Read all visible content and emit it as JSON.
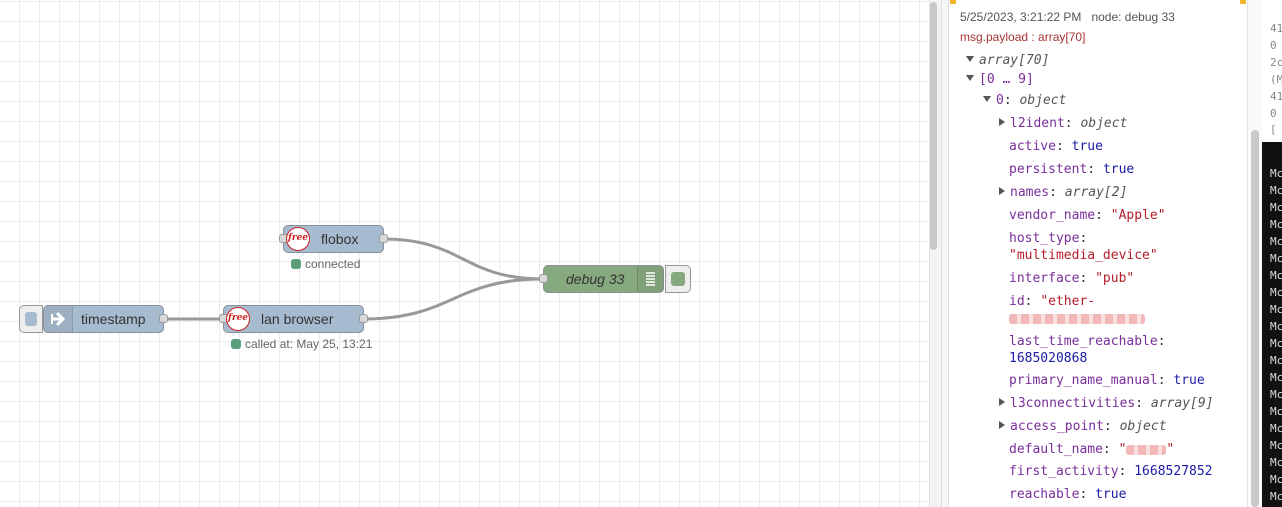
{
  "canvas": {
    "nodes": {
      "inject": {
        "label": "timestamp"
      },
      "flobox": {
        "label": "flobox",
        "icon": "free-logo-icon",
        "icon_text": "free",
        "status": "connected"
      },
      "lan_browser": {
        "label": "lan browser",
        "icon": "free-logo-icon",
        "icon_text": "free",
        "status": "called at: May 25, 13:21"
      },
      "debug": {
        "label": "debug 33"
      }
    },
    "colors": {
      "function_node": "#a6bbcf",
      "debug_node": "#87a980",
      "status_dot": "#5a9e7b",
      "free_red": "#cc1f1f"
    }
  },
  "debug": {
    "timestamp": "5/25/2023, 3:21:22 PM",
    "node": "node: debug 33",
    "topic": "msg.payload : array[70]",
    "tree": {
      "root": "array[70]",
      "range": "[0 … 9]",
      "item_key": "0",
      "item_type": "object",
      "fields": [
        {
          "key": "l2ident",
          "value": "object",
          "kind": "type",
          "expandable": true
        },
        {
          "key": "active",
          "value": "true",
          "kind": "bool"
        },
        {
          "key": "persistent",
          "value": "true",
          "kind": "bool"
        },
        {
          "key": "names",
          "value": "array[2]",
          "kind": "type",
          "expandable": true
        },
        {
          "key": "vendor_name",
          "value": "\"Apple\"",
          "kind": "str"
        },
        {
          "key": "host_type",
          "value": "\"multimedia_device\"",
          "kind": "str",
          "wrap": true
        },
        {
          "key": "interface",
          "value": "\"pub\"",
          "kind": "str"
        },
        {
          "key": "id",
          "value": "\"ether-",
          "kind": "str",
          "redacted": true
        },
        {
          "key": "last_time_reachable",
          "value": "1685020868",
          "kind": "num",
          "wrap": true
        },
        {
          "key": "primary_name_manual",
          "value": "true",
          "kind": "bool"
        },
        {
          "key": "l3connectivities",
          "value": "array[9]",
          "kind": "type",
          "expandable": true
        },
        {
          "key": "access_point",
          "value": "object",
          "kind": "type",
          "expandable": true
        },
        {
          "key": "default_name",
          "value": "\"",
          "value_end": "\"",
          "kind": "str",
          "redacted_inline": true
        },
        {
          "key": "first_activity",
          "value": "1668527852",
          "kind": "num"
        },
        {
          "key": "reachable",
          "value": "true",
          "kind": "bool"
        }
      ]
    }
  },
  "terminal": {
    "top_lines": [
      "41",
      "0",
      "2c",
      "(M",
      "41",
      "0",
      "["
    ],
    "lower_lines": [
      "Mc",
      "Mc",
      "Mc",
      "Mc",
      "Mc",
      "Mc",
      "Mc",
      "Mc",
      "Mc",
      "Mc",
      "Mc",
      "Mc",
      "Mc",
      "Mc",
      "Mc",
      "Mc",
      "Mc",
      "Mc",
      "Mc",
      "Mc"
    ]
  }
}
